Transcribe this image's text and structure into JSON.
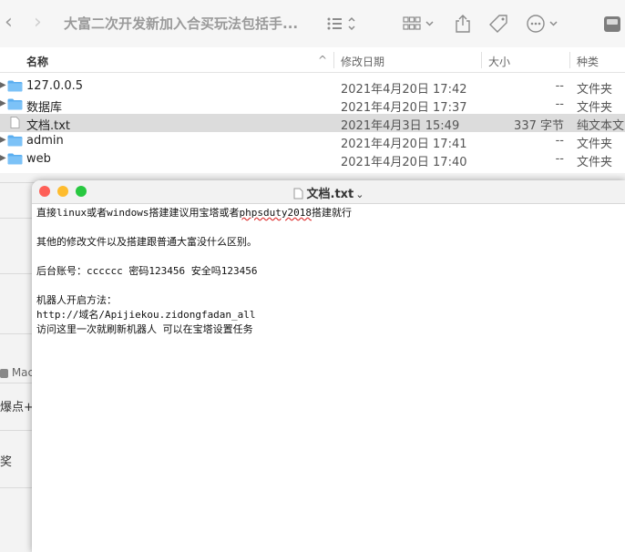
{
  "toolbar": {
    "back_glyph": "‹",
    "forward_glyph": "›",
    "title": "大富二次开发新加入合买玩法包括手..."
  },
  "columns": {
    "name": "名称",
    "date": "修改日期",
    "size": "大小",
    "kind": "种类",
    "sort_glyph": "^"
  },
  "files": [
    {
      "name": "127.0.0.5",
      "date": "2021年4月20日 17:42",
      "size": "--",
      "kind": "文件夹",
      "type": "folder"
    },
    {
      "name": "数据库",
      "date": "2021年4月20日 17:37",
      "size": "--",
      "kind": "文件夹",
      "type": "folder"
    },
    {
      "name": "文档.txt",
      "date": "2021年4月3日 15:49",
      "size": "337 字节",
      "kind": "纯文本文",
      "type": "text",
      "selected": true
    },
    {
      "name": "admin",
      "date": "2021年4月20日 17:41",
      "size": "--",
      "kind": "文件夹",
      "type": "folder"
    },
    {
      "name": "web",
      "date": "2021年4月20日 17:40",
      "size": "--",
      "kind": "文件夹",
      "type": "folder"
    }
  ],
  "sidebar_fragments": {
    "mac": "Mac",
    "fragment1": "爆点+财",
    "fragment2": "奖"
  },
  "textedit": {
    "window_title": "文档.txt",
    "title_chevron": "⌄",
    "lines": [
      "直接linux或者windows搭建建议用宝塔或者",
      "",
      "其他的修改文件以及搭建跟普通大富没什么区别。",
      "",
      "后台账号：cccccc 密码123456 安全吗123456",
      "",
      "机器人开启方法：",
      "http://域名/Apijiekou.zidongfadan_all",
      "访问这里一次就刷新机器人 可以在宝塔设置任务"
    ],
    "line1_underlined": "phpsduty2018",
    "line1_tail": "搭建就行"
  },
  "colors": {
    "folder_blue": "#5aaef0",
    "close": "#fe5f57",
    "minimize": "#febc2e",
    "zoom": "#28c840"
  }
}
